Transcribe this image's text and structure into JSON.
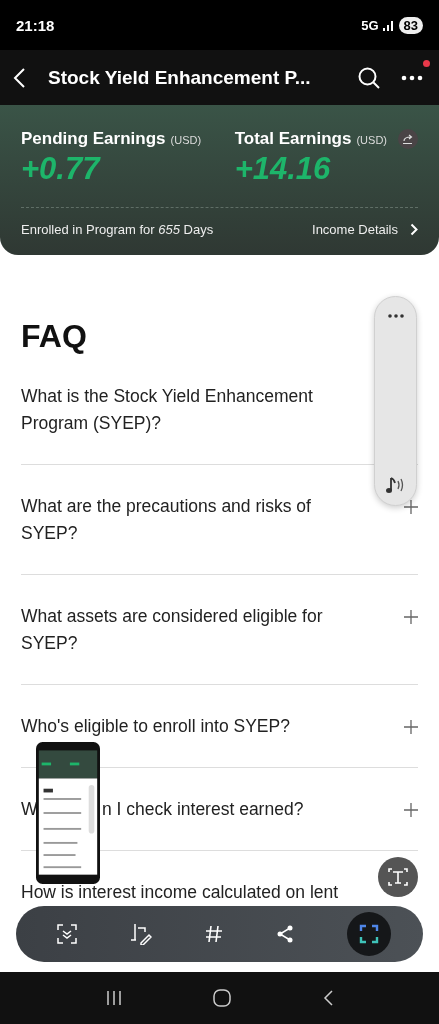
{
  "status_bar": {
    "time": "21:18",
    "network": "5G",
    "battery": "83"
  },
  "header": {
    "title": "Stock Yield Enhancement P...",
    "notification_dot": true
  },
  "earnings": [
    {
      "label": "Pending Earnings",
      "unit": "(USD)",
      "value": "+0.77",
      "has_share": false
    },
    {
      "label": "Total Earnings",
      "unit": "(USD)",
      "value": "+14.16",
      "has_share": true
    }
  ],
  "enrolled": "Enrolled in Program for *655* Days",
  "income_link": "Income Details",
  "faq": {
    "title": "FAQ",
    "items": [
      {
        "question": "What is the Stock Yield Enhancement Program (SYEP)?"
      },
      {
        "question": "What are the precautions and risks of SYEP?"
      },
      {
        "question": "What assets are considered eligible for SYEP?"
      },
      {
        "question": "Who's eligible to enroll into SYEP?"
      },
      {
        "question": "n I check interest earned?",
        "covered_start": "W"
      },
      {
        "question": "How is interest income calculated on lent"
      }
    ]
  }
}
